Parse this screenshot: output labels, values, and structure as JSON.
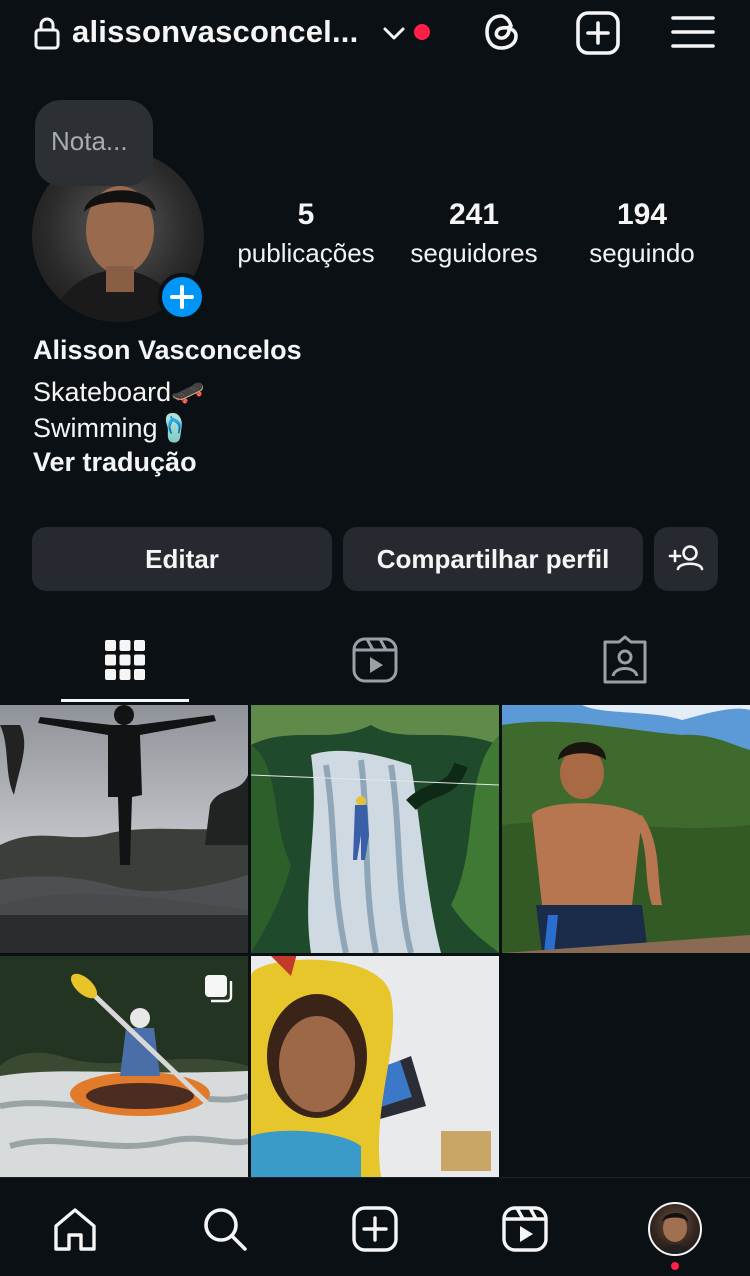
{
  "header": {
    "username": "alissonvasconcel..."
  },
  "profile": {
    "note": "Nota...",
    "stats": [
      {
        "value": "5",
        "label": "publicações"
      },
      {
        "value": "241",
        "label": "seguidores"
      },
      {
        "value": "194",
        "label": "seguindo"
      }
    ],
    "name": "Alisson Vasconcelos",
    "bio": [
      "Skateboard🛹",
      "Swimming🩴"
    ],
    "translate": "Ver tradução"
  },
  "actions": {
    "edit": "Editar",
    "share": "Compartilhar perfil"
  },
  "tabs": [
    "grid-icon",
    "reels-icon",
    "tagged-icon"
  ],
  "grid": [
    "post-silhouette-sunset",
    "post-waterfall-rappel",
    "post-shirtless-mountain",
    "post-kayak-rapids",
    "post-yellow-costume-selfie"
  ],
  "nav": [
    "home-icon",
    "search-icon",
    "create-icon",
    "reels-icon",
    "profile-avatar"
  ],
  "colors": {
    "background": "#0b1014",
    "accent": "#0095f6",
    "button": "#262a30",
    "notification": "#ff1f47"
  }
}
